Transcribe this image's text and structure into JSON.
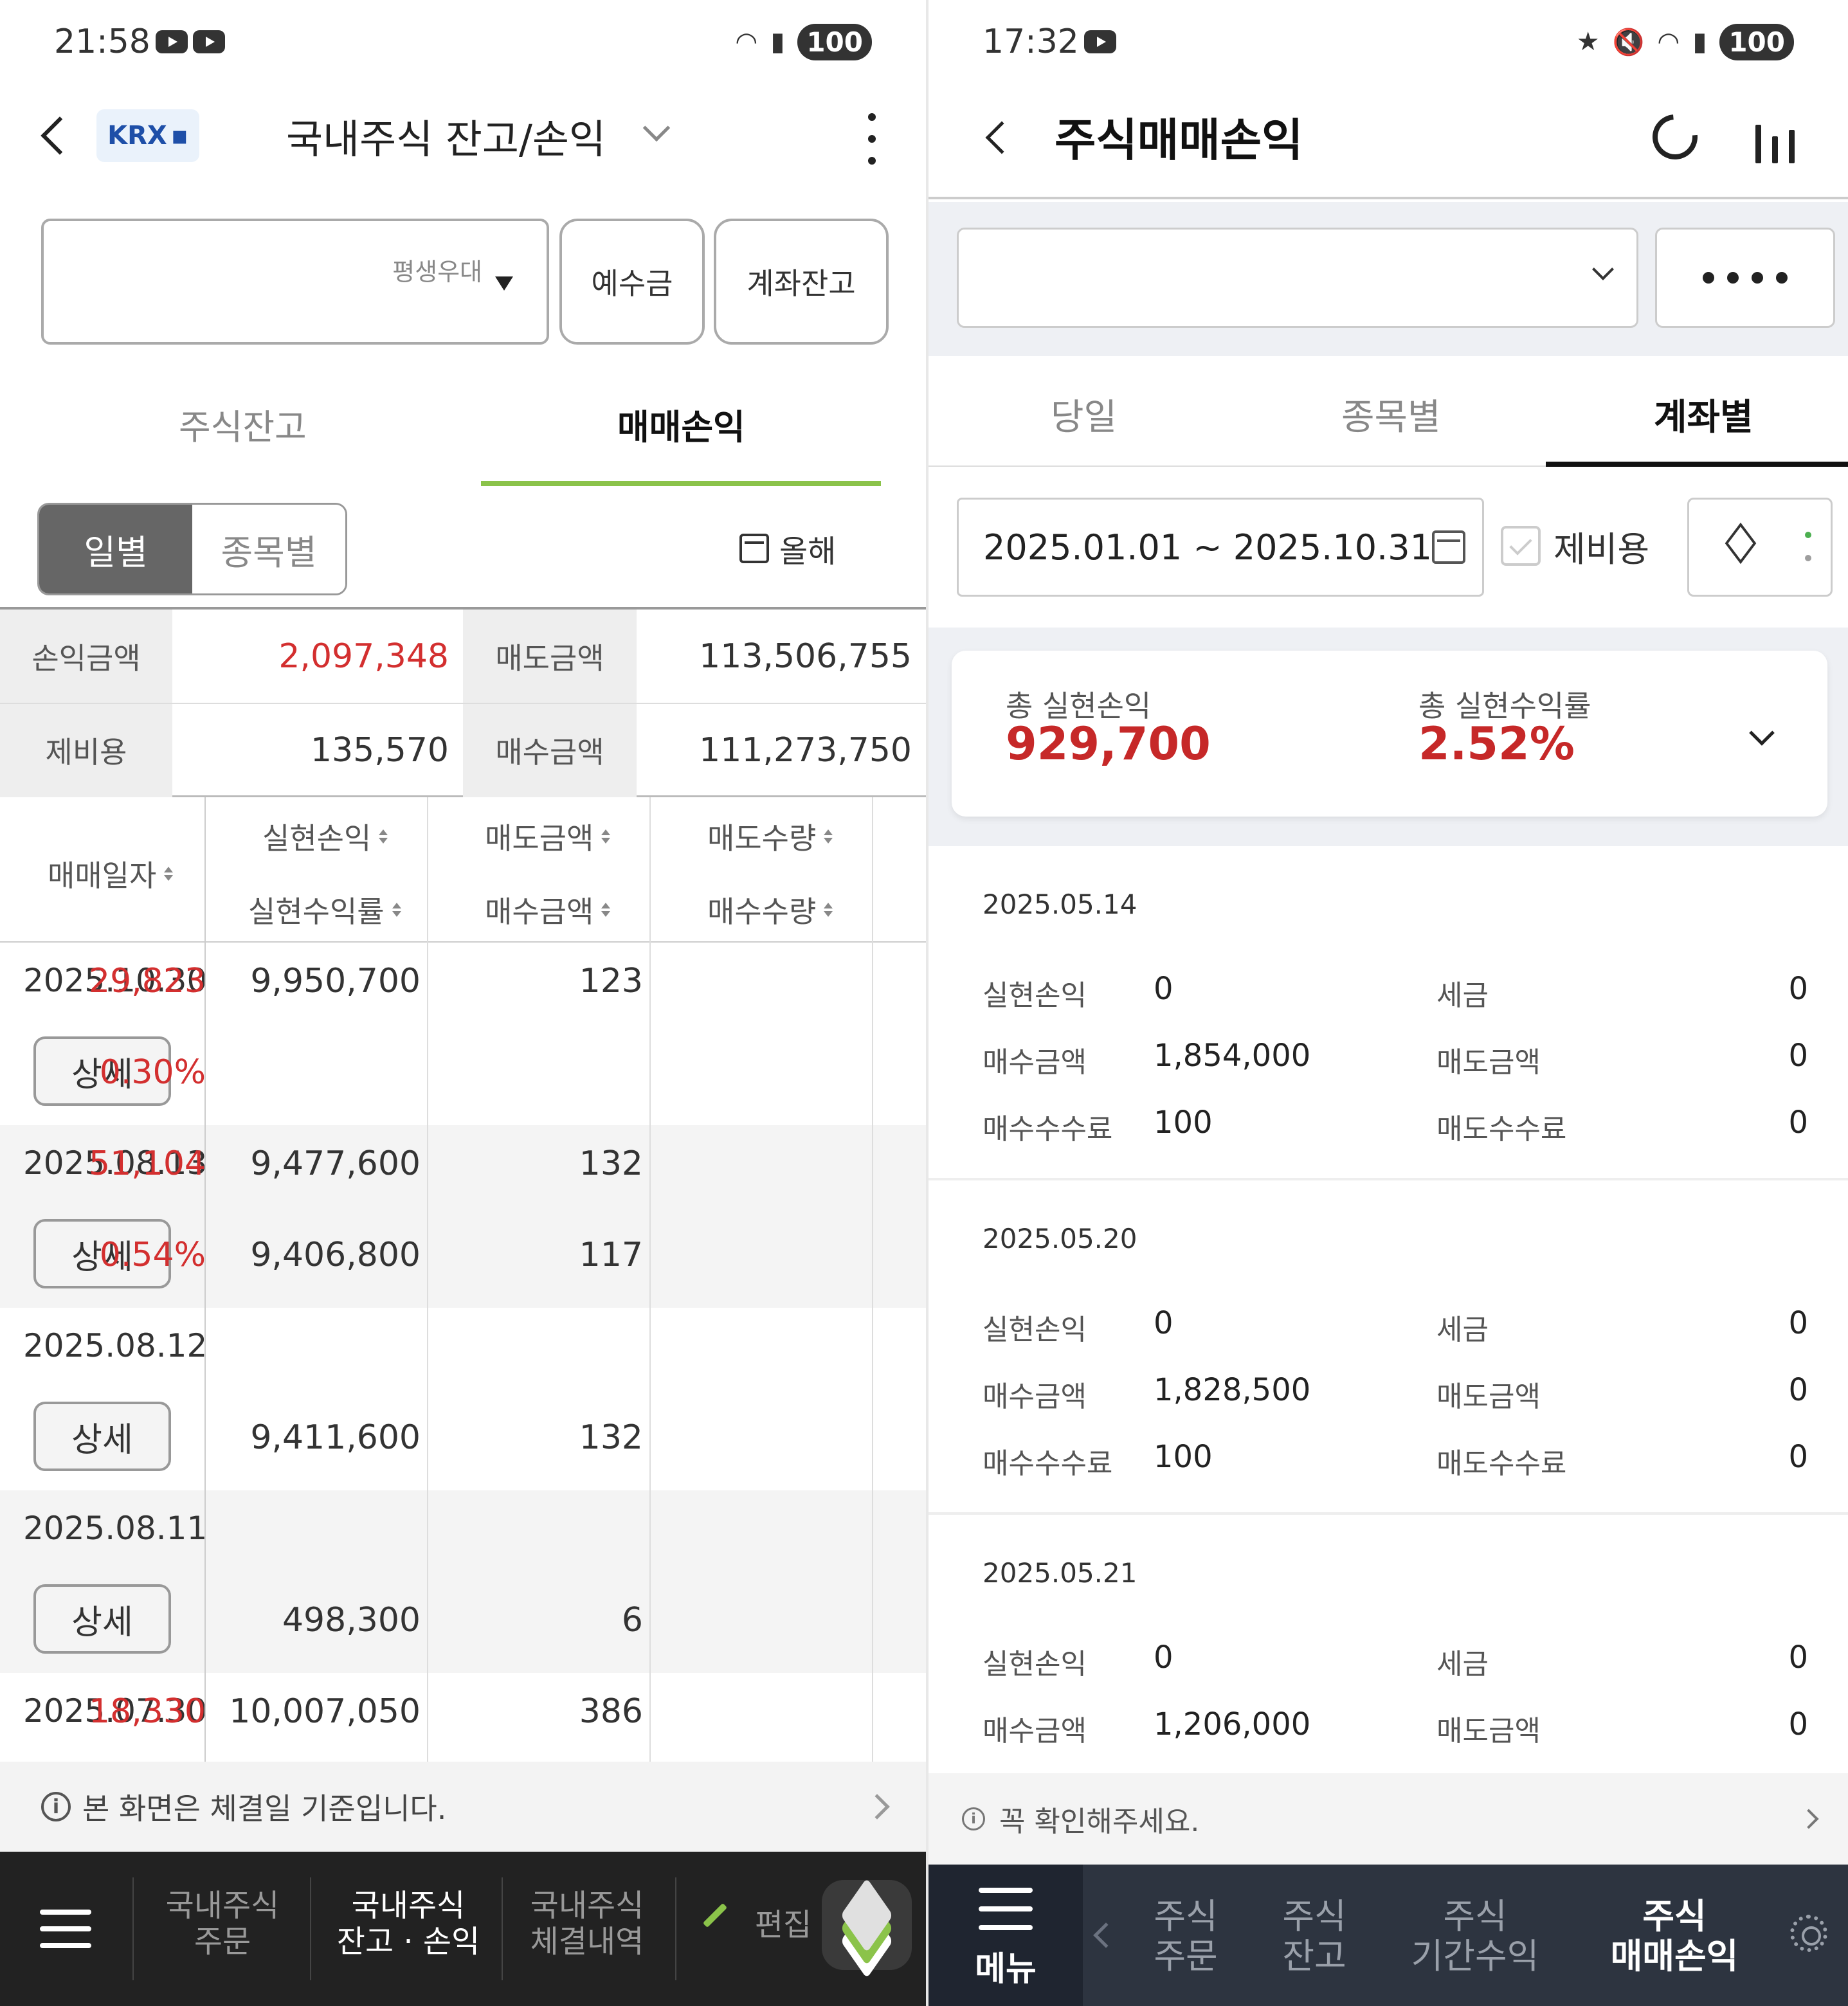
{
  "left": {
    "status": {
      "time": "21:58",
      "battery": "100"
    },
    "header": {
      "exchange": "KRX",
      "title": "국내주식 잔고/손익"
    },
    "account": {
      "placeholder": "평생우대"
    },
    "buttons": {
      "deposit": "예수금",
      "account_balance": "계좌잔고"
    },
    "tabs": [
      "주식잔고",
      "매매손익"
    ],
    "segment": [
      "일별",
      "종목별"
    ],
    "period": "올해",
    "summary": {
      "pl_label": "손익금액",
      "pl_value": "2,097,348",
      "sell_label": "매도금액",
      "sell_value": "113,506,755",
      "fee_label": "제비용",
      "fee_value": "135,570",
      "buy_label": "매수금액",
      "buy_value": "111,273,750"
    },
    "columns": {
      "date": "매매일자",
      "realized_pl": "실현손익",
      "realized_rate": "실현수익률",
      "sell_amount": "매도금액",
      "buy_amount": "매수금액",
      "sell_qty": "매도수량",
      "buy_qty": "매수수량"
    },
    "detail_label": "상세",
    "rows": [
      {
        "date": "2025.10.30",
        "pl": "29,823",
        "rate": "0.30%",
        "sell": "9,950,700",
        "buy": "",
        "sell_qty": "123",
        "buy_qty": ""
      },
      {
        "date": "2025.08.13",
        "pl": "51,104",
        "rate": "0.54%",
        "sell": "9,477,600",
        "buy": "9,406,800",
        "sell_qty": "132",
        "buy_qty": "117"
      },
      {
        "date": "2025.08.12",
        "pl": "",
        "rate": "",
        "sell": "",
        "buy": "9,411,600",
        "sell_qty": "",
        "buy_qty": "132"
      },
      {
        "date": "2025.08.11",
        "pl": "",
        "rate": "",
        "sell": "",
        "buy": "498,300",
        "sell_qty": "",
        "buy_qty": "6"
      },
      {
        "date": "2025.07.30",
        "pl": "18,330",
        "rate": "",
        "sell": "10,007,050",
        "buy": "",
        "sell_qty": "386",
        "buy_qty": ""
      }
    ],
    "notice": "본 화면은 체결일 기준입니다.",
    "bottom_nav": {
      "items": [
        {
          "line1": "국내주식",
          "line2": "주문"
        },
        {
          "line1": "국내주식",
          "line2": "잔고 · 손익"
        },
        {
          "line1": "국내주식",
          "line2": "체결내역"
        }
      ],
      "edit": "편집"
    }
  },
  "right": {
    "status": {
      "time": "17:32",
      "battery": "100"
    },
    "header": {
      "title": "주식매매손익"
    },
    "tabs": [
      "당일",
      "종목별",
      "계좌별"
    ],
    "date_range": "2025.01.01 ~ 2025.10.31",
    "fee_checkbox": "제비용",
    "summary": {
      "realized_pl_label": "총 실현손익",
      "realized_pl": "929,700",
      "realized_rate_label": "총 실현수익률",
      "realized_rate": "2.52%"
    },
    "labels": {
      "realized_pl": "실현손익",
      "tax": "세금",
      "buy_amount": "매수금액",
      "sell_amount": "매도금액",
      "buy_fee": "매수수수료",
      "sell_fee": "매도수수료"
    },
    "cards": [
      {
        "date": "2025.05.14",
        "realized_pl": "0",
        "tax": "0",
        "buy_amount": "1,854,000",
        "sell_amount": "0",
        "buy_fee": "100",
        "sell_fee": "0"
      },
      {
        "date": "2025.05.20",
        "realized_pl": "0",
        "tax": "0",
        "buy_amount": "1,828,500",
        "sell_amount": "0",
        "buy_fee": "100",
        "sell_fee": "0"
      },
      {
        "date": "2025.05.21",
        "realized_pl": "0",
        "tax": "0",
        "buy_amount": "1,206,000",
        "sell_amount": "0"
      }
    ],
    "notice": "꼭 확인해주세요.",
    "bottom_nav": {
      "menu": "메뉴",
      "items": [
        {
          "line1": "주식",
          "line2": "주문"
        },
        {
          "line1": "주식",
          "line2": "잔고"
        },
        {
          "line1": "주식",
          "line2": "기간수익"
        },
        {
          "line1": "주식",
          "line2": "매매손익"
        }
      ]
    }
  }
}
